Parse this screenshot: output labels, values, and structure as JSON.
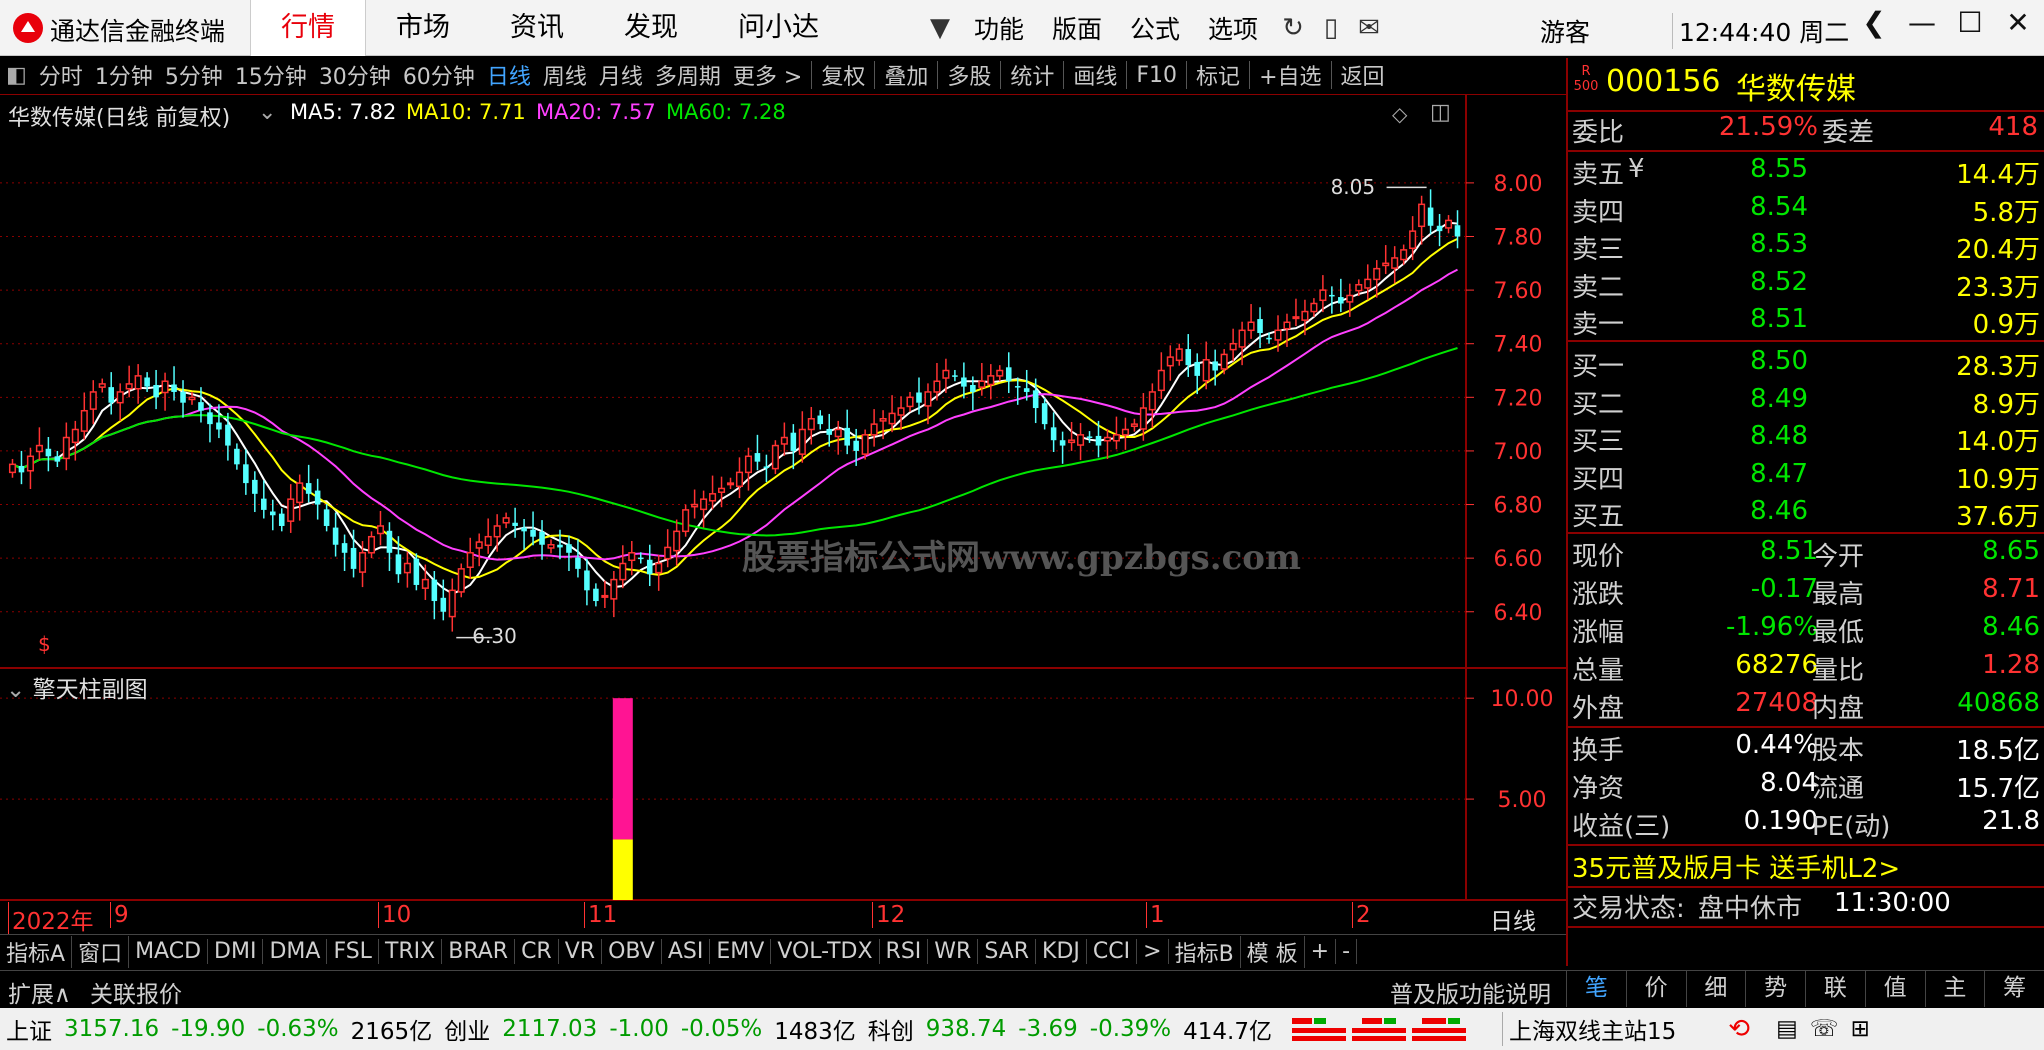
{
  "app": {
    "name": "通达信金融终端",
    "guest": "游客",
    "clock": "12:44:40 周二"
  },
  "menu": [
    {
      "label": "行情",
      "active": true
    },
    {
      "label": "市场"
    },
    {
      "label": "资讯"
    },
    {
      "label": "发现"
    },
    {
      "label": "问小达"
    }
  ],
  "tools": [
    "功能",
    "版面",
    "公式",
    "选项"
  ],
  "periods": [
    {
      "label": "分时"
    },
    {
      "label": "1分钟"
    },
    {
      "label": "5分钟"
    },
    {
      "label": "15分钟"
    },
    {
      "label": "30分钟"
    },
    {
      "label": "60分钟"
    },
    {
      "label": "日线",
      "selected": true
    },
    {
      "label": "周线"
    },
    {
      "label": "月线"
    },
    {
      "label": "多周期"
    },
    {
      "label": "更多 >"
    }
  ],
  "actions": [
    "复权",
    "叠加",
    "多股",
    "统计",
    "画线",
    "F10",
    "标记",
    "+自选",
    "返回"
  ],
  "chart": {
    "title": "华数传媒(日线 前复权)",
    "ma": [
      {
        "label": "MA5: 7.82",
        "color": "#ffffff"
      },
      {
        "label": "MA10: 7.71",
        "color": "#ffff00"
      },
      {
        "label": "MA20: 7.57",
        "color": "#ff40ff"
      },
      {
        "label": "MA60: 7.28",
        "color": "#00e600"
      }
    ],
    "high_label": "8.05",
    "low_label": "6.30",
    "watermark": "股票指标公式网www.gpzbgs.com",
    "sub_title": "擎天柱副图",
    "dates": [
      {
        "label": "2022年",
        "x": 8
      },
      {
        "label": "9",
        "x": 110
      },
      {
        "label": "10",
        "x": 378
      },
      {
        "label": "11",
        "x": 584
      },
      {
        "label": "12",
        "x": 872
      },
      {
        "label": "1",
        "x": 1146
      },
      {
        "label": "2",
        "x": 1352
      }
    ],
    "period_label": "日线"
  },
  "chart_data": {
    "type": "candlestick",
    "y_ticks": [
      "8.00",
      "7.80",
      "7.60",
      "7.40",
      "7.20",
      "7.00",
      "6.80",
      "6.60",
      "6.40"
    ],
    "y_range": [
      6.22,
      8.16
    ],
    "sub_ticks": [
      "10.00",
      "5.00"
    ],
    "sub_range": [
      0,
      11
    ],
    "sub_bar": {
      "index": 68,
      "top_value": 10.0,
      "split_value": 3.0
    },
    "closes": [
      6.95,
      6.92,
      6.98,
      7.02,
      6.98,
      6.96,
      7.05,
      7.08,
      7.15,
      7.22,
      7.25,
      7.18,
      7.22,
      7.25,
      7.28,
      7.24,
      7.2,
      7.26,
      7.22,
      7.18,
      7.2,
      7.15,
      7.1,
      7.08,
      7.02,
      6.95,
      6.88,
      6.84,
      6.78,
      6.76,
      6.72,
      6.82,
      6.88,
      6.84,
      6.8,
      6.72,
      6.65,
      6.62,
      6.56,
      6.62,
      6.68,
      6.72,
      6.62,
      6.54,
      6.58,
      6.5,
      6.52,
      6.44,
      6.4,
      6.48,
      6.56,
      6.62,
      6.66,
      6.68,
      6.72,
      6.75,
      6.72,
      6.7,
      6.68,
      6.65,
      6.65,
      6.64,
      6.62,
      6.56,
      6.48,
      6.44,
      6.46,
      6.52,
      6.58,
      6.62,
      6.6,
      6.54,
      6.58,
      6.64,
      6.7,
      6.78,
      6.8,
      6.82,
      6.84,
      6.86,
      6.88,
      6.92,
      6.98,
      6.96,
      6.94,
      7.02,
      7.05,
      7.0,
      7.08,
      7.12,
      7.1,
      7.06,
      7.08,
      7.02,
      7.0,
      7.06,
      7.1,
      7.12,
      7.14,
      7.16,
      7.2,
      7.18,
      7.22,
      7.26,
      7.3,
      7.28,
      7.24,
      7.22,
      7.26,
      7.28,
      7.3,
      7.26,
      7.24,
      7.22,
      7.16,
      7.1,
      7.04,
      7.02,
      7.04,
      7.06,
      7.05,
      7.02,
      7.05,
      7.06,
      7.08,
      7.1,
      7.16,
      7.22,
      7.3,
      7.35,
      7.38,
      7.32,
      7.28,
      7.34,
      7.3,
      7.36,
      7.4,
      7.45,
      7.48,
      7.44,
      7.42,
      7.45,
      7.48,
      7.5,
      7.52,
      7.55,
      7.6,
      7.58,
      7.55,
      7.58,
      7.62,
      7.64,
      7.68,
      7.7,
      7.72,
      7.75,
      7.82,
      7.92,
      7.84,
      7.82,
      7.86,
      7.8
    ],
    "ma_color": {
      "MA5": "#ffffff",
      "MA10": "#ffff00",
      "MA20": "#ff40ff",
      "MA60": "#00e600"
    }
  },
  "quote": {
    "code": "000156",
    "name": "华数传媒",
    "badge": "R\n500",
    "wb_label": "委比",
    "wb_value": "21.59%",
    "wc_label": "委差",
    "wc_value": "418",
    "asks": [
      {
        "label": "卖五",
        "flag": "¥",
        "price": "8.55",
        "vol": "14.4万"
      },
      {
        "label": "卖四",
        "price": "8.54",
        "vol": "5.8万"
      },
      {
        "label": "卖三",
        "price": "8.53",
        "vol": "20.4万"
      },
      {
        "label": "卖二",
        "price": "8.52",
        "vol": "23.3万"
      },
      {
        "label": "卖一",
        "price": "8.51",
        "vol": "0.9万"
      }
    ],
    "bids": [
      {
        "label": "买一",
        "price": "8.50",
        "vol": "28.3万"
      },
      {
        "label": "买二",
        "price": "8.49",
        "vol": "8.9万"
      },
      {
        "label": "买三",
        "price": "8.48",
        "vol": "14.0万"
      },
      {
        "label": "买四",
        "price": "8.47",
        "vol": "10.9万"
      },
      {
        "label": "买五",
        "price": "8.46",
        "vol": "37.6万"
      }
    ],
    "stats": [
      {
        "l1": "现价",
        "v1": "8.51",
        "c1": "green",
        "l2": "今开",
        "v2": "8.65",
        "c2": "green"
      },
      {
        "l1": "涨跌",
        "v1": "-0.17",
        "c1": "green",
        "l2": "最高",
        "v2": "8.71",
        "c2": "red"
      },
      {
        "l1": "涨幅",
        "v1": "-1.96%",
        "c1": "green",
        "l2": "最低",
        "v2": "8.46",
        "c2": "green"
      },
      {
        "l1": "总量",
        "v1": "68276",
        "c1": "yellow",
        "l2": "量比",
        "v2": "1.28",
        "c2": "red"
      },
      {
        "l1": "外盘",
        "v1": "27408",
        "c1": "red",
        "l2": "内盘",
        "v2": "40868",
        "c2": "green"
      }
    ],
    "stats2": [
      {
        "l1": "换手",
        "v1": "0.44%",
        "l2": "股本",
        "v2": "18.5亿"
      },
      {
        "l1": "净资",
        "v1": "8.04",
        "l2": "流通",
        "v2": "15.7亿"
      },
      {
        "l1": "收益(三)",
        "v1": "0.190",
        "l2": "PE(动)",
        "v2": "21.8"
      }
    ],
    "promo": "35元普及版月卡 送手机L2>",
    "trade_status_label": "交易状态:",
    "trade_status": "盘中休市",
    "trade_time": "11:30:00"
  },
  "indicator_tabs": [
    "指标A",
    "窗口",
    "MACD",
    "DMI",
    "DMA",
    "FSL",
    "TRIX",
    "BRAR",
    "CR",
    "VR",
    "OBV",
    "ASI",
    "EMV",
    "VOL-TDX",
    "RSI",
    "WR",
    "SAR",
    "KDJ",
    "CCI",
    ">",
    "指标B",
    "模 板",
    "+",
    "-"
  ],
  "ext": {
    "expand": "扩展∧",
    "related": "关联报价",
    "puji": "普及版功能说明",
    "right_tabs": [
      "笔",
      "价",
      "细",
      "势",
      "联",
      "值",
      "主",
      "筹"
    ]
  },
  "status": {
    "sh_label": "上证",
    "sh_val": "3157.16",
    "sh_chg": "-19.90",
    "sh_pct": "-0.63%",
    "sh_amt": "2165亿",
    "cy_label": "创业",
    "cy_val": "2117.03",
    "cy_chg": "-1.00",
    "cy_pct": "-0.05%",
    "cy_amt": "1483亿",
    "kc_label": "科创",
    "kc_val": "938.74",
    "kc_chg": "-3.69",
    "kc_pct": "-0.39%",
    "kc_amt": "414.7亿",
    "server": "上海双线主站15"
  }
}
